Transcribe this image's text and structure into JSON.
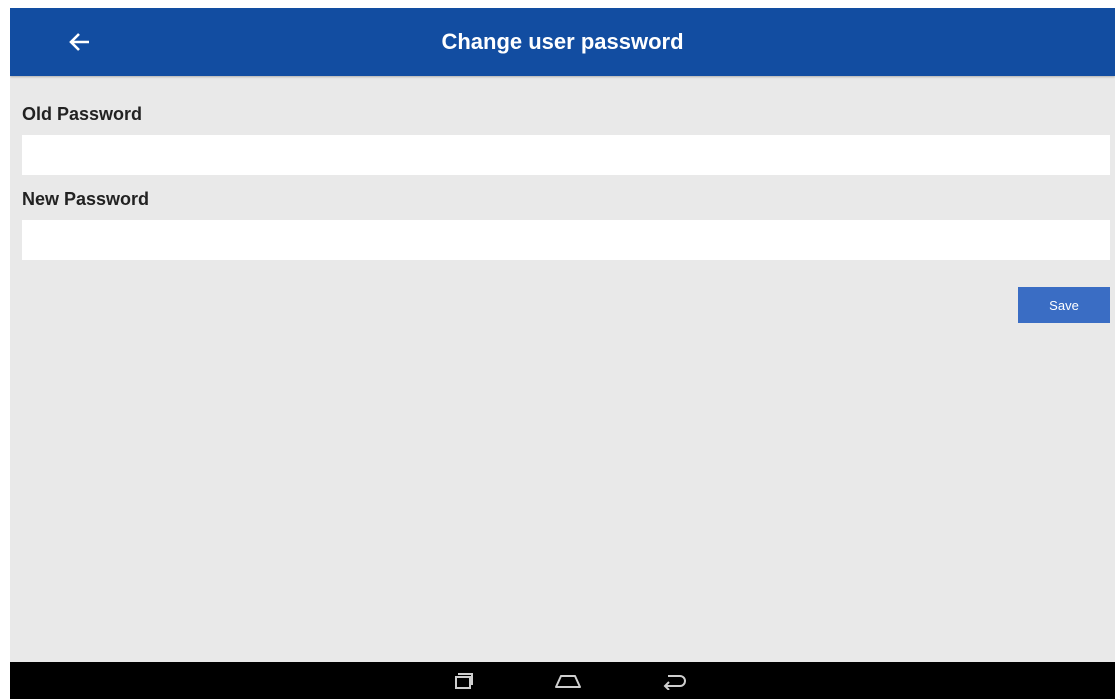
{
  "appbar": {
    "title": "Change user password",
    "back_icon": "arrow-left-icon",
    "color": "#124da1"
  },
  "form": {
    "old_password": {
      "label": "Old Password",
      "value": "",
      "placeholder": ""
    },
    "new_password": {
      "label": "New Password",
      "value": "",
      "placeholder": ""
    },
    "save_label": "Save",
    "save_color": "#3a6dc4"
  },
  "navbar": {
    "buttons": [
      {
        "icon": "recent-apps-icon"
      },
      {
        "icon": "home-icon"
      },
      {
        "icon": "back-icon"
      }
    ]
  }
}
